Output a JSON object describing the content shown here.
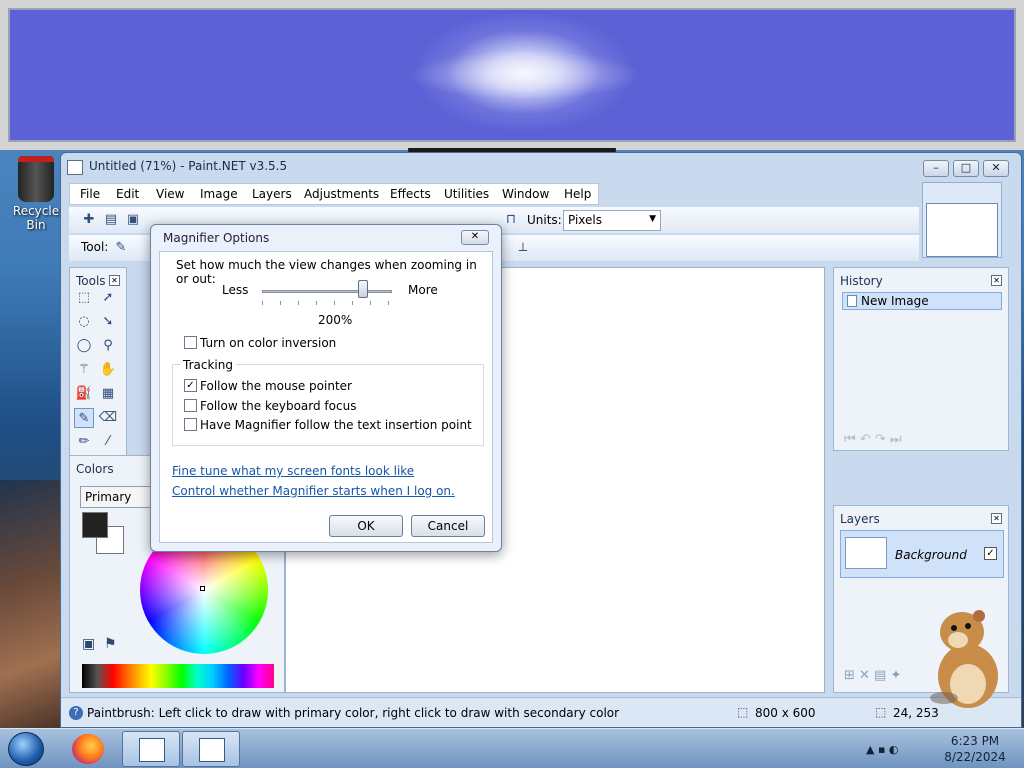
{
  "desktop": {
    "recycle_bin_label": "Recycle Bin"
  },
  "paintnet": {
    "title": "Untitled (71%) - Paint.NET v3.5.5",
    "menus": [
      "File",
      "Edit",
      "View",
      "Image",
      "Layers",
      "Adjustments",
      "Effects",
      "Utilities",
      "Window",
      "Help"
    ],
    "units_label": "Units:",
    "units_value": "Pixels",
    "tool_label": "Tool:",
    "tools_panel_title": "Tools",
    "colors_panel_title": "Colors",
    "colors_mode": "Primary",
    "history_title": "History",
    "history_item": "New Image",
    "layers_title": "Layers",
    "layer_name": "Background",
    "status_text": "Paintbrush: Left click to draw with primary color, right click to draw with secondary color",
    "image_size": "800 x 600",
    "cursor_pos": "24, 253"
  },
  "dialog": {
    "title": "Magnifier Options",
    "intro": "Set how much the view changes when zooming in or out:",
    "less": "Less",
    "more": "More",
    "zoom_value": "200%",
    "color_inversion": "Turn on color inversion",
    "tracking_label": "Tracking",
    "follow_mouse": "Follow the mouse pointer",
    "follow_keyboard": "Follow the keyboard focus",
    "follow_text": "Have Magnifier follow the text insertion point",
    "link_fonts": "Fine tune what my screen fonts look like",
    "link_startup": "Control whether Magnifier starts when I log on.",
    "ok": "OK",
    "cancel": "Cancel",
    "checkbox_states": {
      "color_inversion": false,
      "follow_mouse": true,
      "follow_keyboard": false,
      "follow_text": false
    }
  },
  "taskbar": {
    "time": "6:23 PM",
    "date": "8/22/2024"
  },
  "colors": {
    "accent": "#1558a8",
    "lens_blue": "#5c62d6"
  }
}
